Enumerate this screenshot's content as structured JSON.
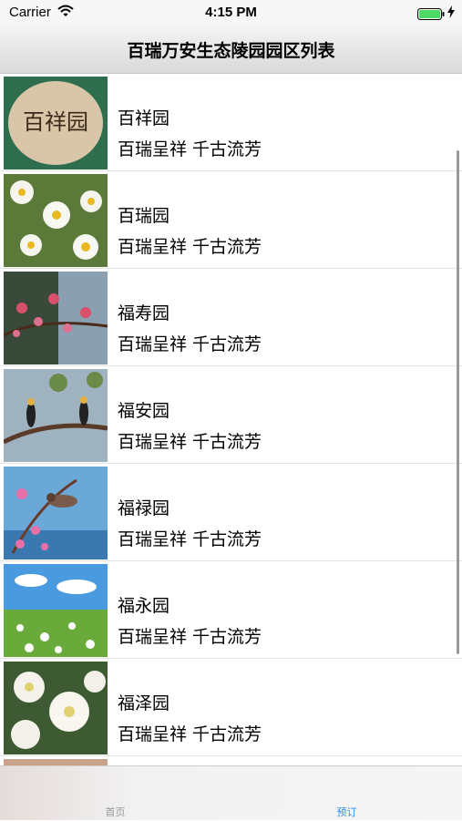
{
  "status_bar": {
    "carrier": "Carrier",
    "time": "4:15 PM"
  },
  "nav": {
    "title": "百瑞万安生态陵园园区列表"
  },
  "list": {
    "items": [
      {
        "title": "百祥园",
        "subtitle": "百瑞呈祥 千古流芳",
        "thumb_text": "百祥园"
      },
      {
        "title": "百瑞园",
        "subtitle": "百瑞呈祥 千古流芳"
      },
      {
        "title": "福寿园",
        "subtitle": "百瑞呈祥 千古流芳"
      },
      {
        "title": "福安园",
        "subtitle": "百瑞呈祥 千古流芳"
      },
      {
        "title": "福禄园",
        "subtitle": "百瑞呈祥 千古流芳"
      },
      {
        "title": "福永园",
        "subtitle": "百瑞呈祥 千古流芳"
      },
      {
        "title": "福泽园",
        "subtitle": "百瑞呈祥 千古流芳"
      }
    ]
  },
  "tab_bar": {
    "tabs": [
      {
        "label": "首页",
        "selected": false
      },
      {
        "label": "预订",
        "selected": true
      }
    ]
  },
  "colors": {
    "accent": "#2f8cf6",
    "battery": "#4cd964"
  }
}
